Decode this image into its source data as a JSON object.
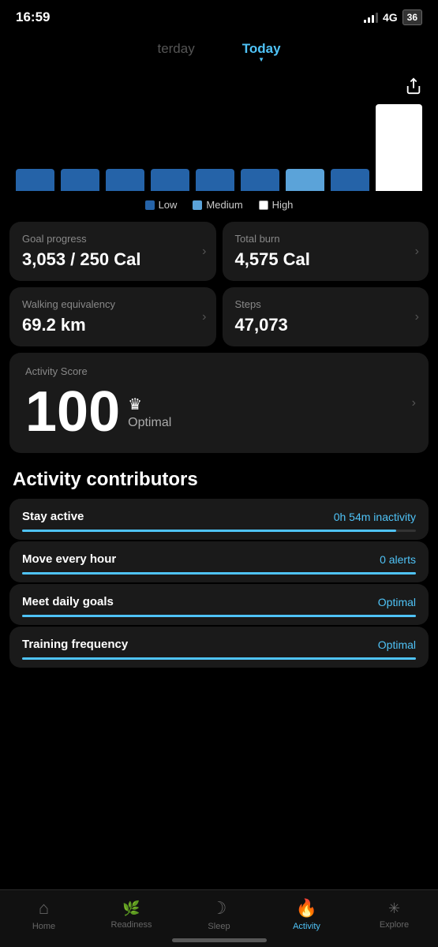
{
  "statusBar": {
    "time": "16:59",
    "network": "4G",
    "battery": "36"
  },
  "navTabs": {
    "previous": "terday",
    "current": "Today",
    "active": "Today"
  },
  "legend": {
    "low": "Low",
    "medium": "Medium",
    "high": "High"
  },
  "cards": [
    {
      "label": "Goal progress",
      "value": "3,053 / 250 Cal"
    },
    {
      "label": "Total burn",
      "value": "4,575 Cal"
    },
    {
      "label": "Walking equivalency",
      "value": "69.2 km"
    },
    {
      "label": "Steps",
      "value": "47,073"
    }
  ],
  "activityScore": {
    "label": "Activity Score",
    "value": "100",
    "status": "Optimal"
  },
  "contributorsTitle": "Activity contributors",
  "contributors": [
    {
      "name": "Stay active",
      "value": "0h 54m inactivity",
      "progress": 95
    },
    {
      "name": "Move every hour",
      "value": "0 alerts",
      "progress": 100
    },
    {
      "name": "Meet daily goals",
      "value": "Optimal",
      "progress": 100
    },
    {
      "name": "Training frequency",
      "value": "Optimal",
      "progress": 100
    }
  ],
  "bottomNav": [
    {
      "icon": "🏠",
      "label": "Home",
      "active": false
    },
    {
      "icon": "♡",
      "label": "Readiness",
      "active": false
    },
    {
      "icon": "🌙",
      "label": "Sleep",
      "active": false
    },
    {
      "icon": "🔥",
      "label": "Activity",
      "active": true
    },
    {
      "icon": "✳",
      "label": "Explore",
      "active": false
    }
  ]
}
